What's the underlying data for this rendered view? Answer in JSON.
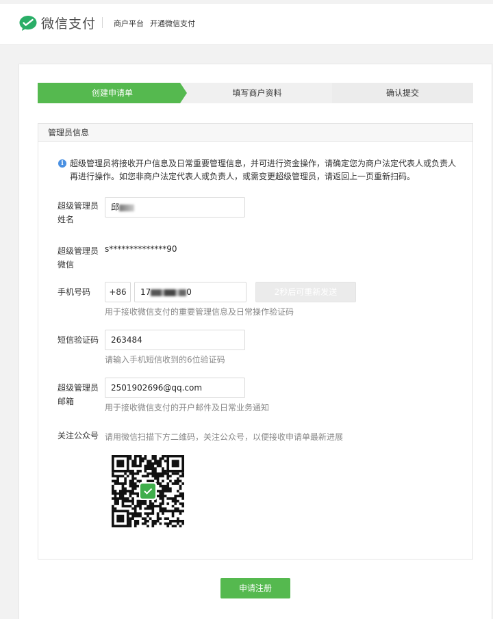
{
  "header": {
    "brand": "微信支付",
    "nav_platform": "商户平台",
    "nav_open": "开通微信支付",
    "brand_color": "#1aad19"
  },
  "steps": [
    {
      "label": "创建申请单",
      "active": true
    },
    {
      "label": "填写商户资料",
      "active": false
    },
    {
      "label": "确认提交",
      "active": false
    }
  ],
  "panel": {
    "title": "管理员信息",
    "notice": "超级管理员将接收开户信息及日常重要管理信息，并可进行资金操作，请确定您为商户法定代表人或负责人再进行操作。如您非商户法定代表人或负责人，或需变更超级管理员，请返回上一页重新扫码。",
    "notice_icon": "info-icon"
  },
  "form": {
    "name": {
      "label": "超级管理员姓名",
      "value": "邱"
    },
    "wechat": {
      "label": "超级管理员微信",
      "value": "s**************90"
    },
    "phone": {
      "label": "手机号码",
      "prefix": "+86",
      "value_start": "17",
      "value_end": "0",
      "resend": "2秒后可重新发送",
      "hint": "用于接收微信支付的重要管理信息及日常操作验证码"
    },
    "sms": {
      "label": "短信验证码",
      "value": "263484",
      "hint": "请输入手机短信收到的6位验证码"
    },
    "email": {
      "label": "超级管理员邮箱",
      "value": "2501902696@qq.com",
      "hint": "用于接收微信支付的开户邮件及日常业务通知"
    },
    "follow": {
      "label": "关注公众号",
      "hint": "请用微信扫描下方二维码，关注公众号，以便接收申请单最新进展"
    }
  },
  "submit_label": "申请注册",
  "accent_color": "#55b94f"
}
